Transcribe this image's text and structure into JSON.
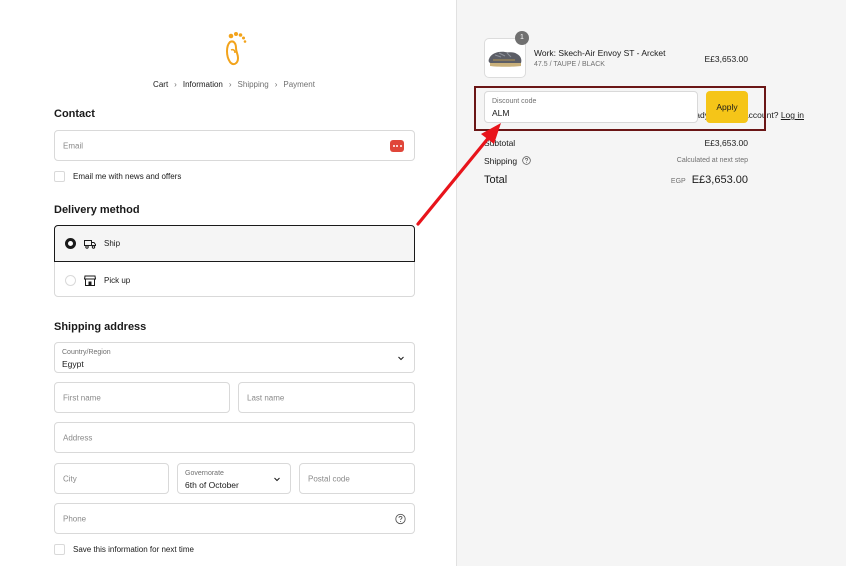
{
  "breadcrumb": {
    "cart": "Cart",
    "information": "Information",
    "shipping": "Shipping",
    "payment": "Payment"
  },
  "contact": {
    "title": "Contact",
    "account_prompt": "Already have an account?",
    "login_label": "Log in",
    "email_placeholder": "Email",
    "newsletter_label": "Email me with news and offers"
  },
  "delivery": {
    "title": "Delivery method",
    "ship_label": "Ship",
    "pickup_label": "Pick up",
    "selected": "Ship"
  },
  "shipping_address": {
    "title": "Shipping address",
    "country_label": "Country/Region",
    "country_value": "Egypt",
    "first_name_placeholder": "First name",
    "last_name_placeholder": "Last name",
    "address_placeholder": "Address",
    "city_placeholder": "City",
    "governorate_label": "Governorate",
    "governorate_value": "6th of October",
    "postal_placeholder": "Postal code",
    "phone_placeholder": "Phone",
    "save_info_label": "Save this information for next time"
  },
  "order": {
    "quantity": "1",
    "product_name": "Work: Skech-Air Envoy ST - Arcket",
    "product_variant": "47.5 / TAUPE / BLACK",
    "product_price": "E£3,653.00",
    "discount_label": "Discount code",
    "discount_value": "ALM",
    "apply_label": "Apply",
    "subtotal_label": "Subtotal",
    "subtotal_value": "E£3,653.00",
    "shipping_label": "Shipping",
    "shipping_value": "Calculated at next step",
    "total_label": "Total",
    "total_currency": "EGP",
    "total_value": "E£3,653.00"
  },
  "colors": {
    "accent_button": "#f5c518",
    "highlight_border": "#6b1616",
    "annotation_arrow": "#e8141b"
  }
}
